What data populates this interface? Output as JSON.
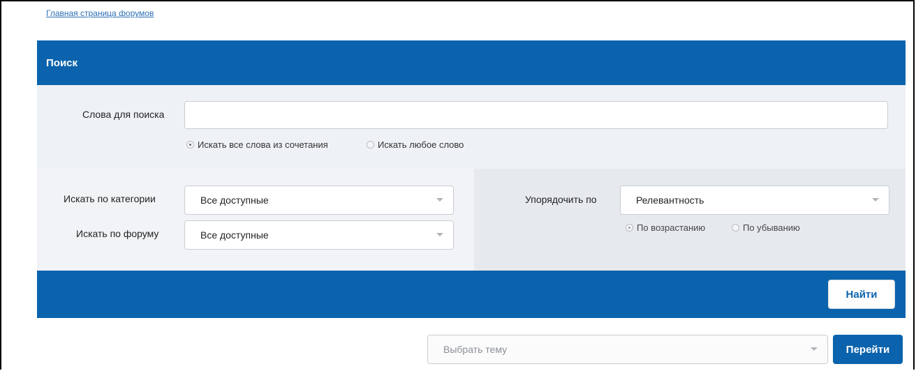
{
  "breadcrumb": {
    "home_link": "Главная страница форумов"
  },
  "panel": {
    "title": "Поиск"
  },
  "search_words": {
    "label": "Слова для поиска",
    "value": "",
    "placeholder": "",
    "mode_options": [
      {
        "label": "Искать все слова из сочетания",
        "selected": true
      },
      {
        "label": "Искать любое слово",
        "selected": false
      }
    ]
  },
  "filters": {
    "category": {
      "label": "Искать по категории",
      "selected": "Все доступные"
    },
    "forum": {
      "label": "Искать по форуму",
      "selected": "Все доступные"
    }
  },
  "sort": {
    "label": "Упорядочить по",
    "selected": "Релевантность",
    "order_options": [
      {
        "label": "По возрастанию",
        "selected": true
      },
      {
        "label": "По убыванию",
        "selected": false
      }
    ]
  },
  "actions": {
    "find_label": "Найти"
  },
  "topic_jump": {
    "placeholder": "Выбрать тему",
    "go_label": "Перейти"
  },
  "colors": {
    "brand_blue": "#0b63ad",
    "link_blue": "#2b6fb4",
    "panel_bg": "#eef1f5"
  }
}
